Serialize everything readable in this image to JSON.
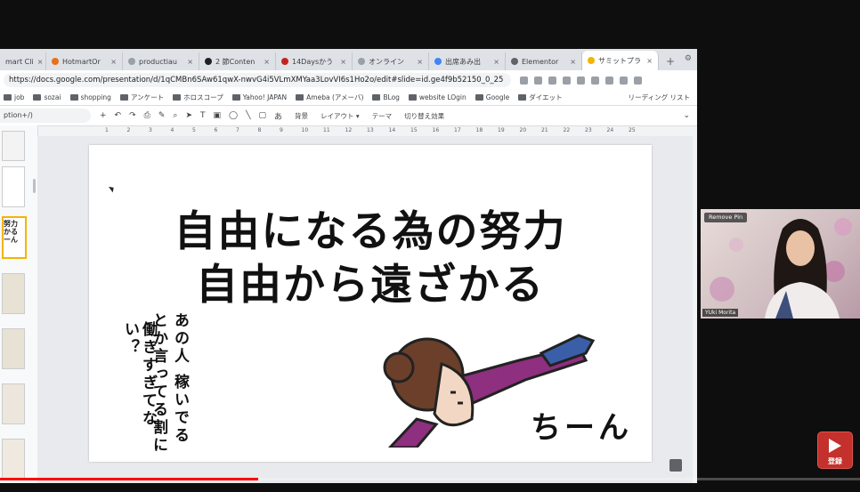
{
  "browser": {
    "tabs": [
      {
        "label": "mart Cli",
        "color": "#ea4335"
      },
      {
        "label": "HotmartOr",
        "color": "#e8711c"
      },
      {
        "label": "productiau",
        "color": "#9aa0a6"
      },
      {
        "label": "2 節Conten",
        "color": "#202124"
      },
      {
        "label": "14Daysかう",
        "color": "#c5221f"
      },
      {
        "label": "オンライン",
        "color": "#9aa0a6"
      },
      {
        "label": "出席あみ出",
        "color": "#4285f4"
      },
      {
        "label": "Elementor",
        "color": "#5f6368"
      },
      {
        "label": "サミットプラ",
        "color": "#f4b400",
        "active": true
      }
    ],
    "url_prefix": "https://",
    "url_host": "docs.google.com",
    "url_path": "/presentation/d/1qCMBn6SAw61qwX-nwvG4i5VLmXMYaa3LovVI6s1Ho2o/edit#slide=id.ge4f9b52150_0_25",
    "bookmarks": [
      "job",
      "sozai",
      "shopping",
      "アンケート",
      "ホロスコープ",
      "Yahoo! JAPAN",
      "Ameba (アメーバ)",
      "BLog",
      "website LOgin",
      "Google",
      "ダイエット"
    ],
    "reading_list": "リーディング リスト"
  },
  "slides_toolbar": {
    "search_text": "ption+/)",
    "items": [
      "背景",
      "レイアウト ▾",
      "テーマ",
      "切り替え効果"
    ]
  },
  "ruler_ticks": [
    "1",
    "2",
    "3",
    "4",
    "5",
    "6",
    "7",
    "8",
    "9",
    "10",
    "11",
    "12",
    "13",
    "14",
    "15",
    "16",
    "17",
    "18",
    "19",
    "20",
    "21",
    "22",
    "23",
    "24",
    "25"
  ],
  "filmstrip": {
    "thumb_text": "努力\nかる\nーん"
  },
  "slide": {
    "line1": "自由になる為の努力",
    "line2": "自由から遠ざかる",
    "vertical_1": "あの人 稼いでる",
    "vertical_2": "とか言ってる割に",
    "vertical_3": "働きすぎてない？",
    "onomatopoeia": "ちーん"
  },
  "webcam": {
    "pin_label": "Remove Pin",
    "name": "YUki Morita"
  },
  "youtube": {
    "subscribe_label": "登録"
  }
}
